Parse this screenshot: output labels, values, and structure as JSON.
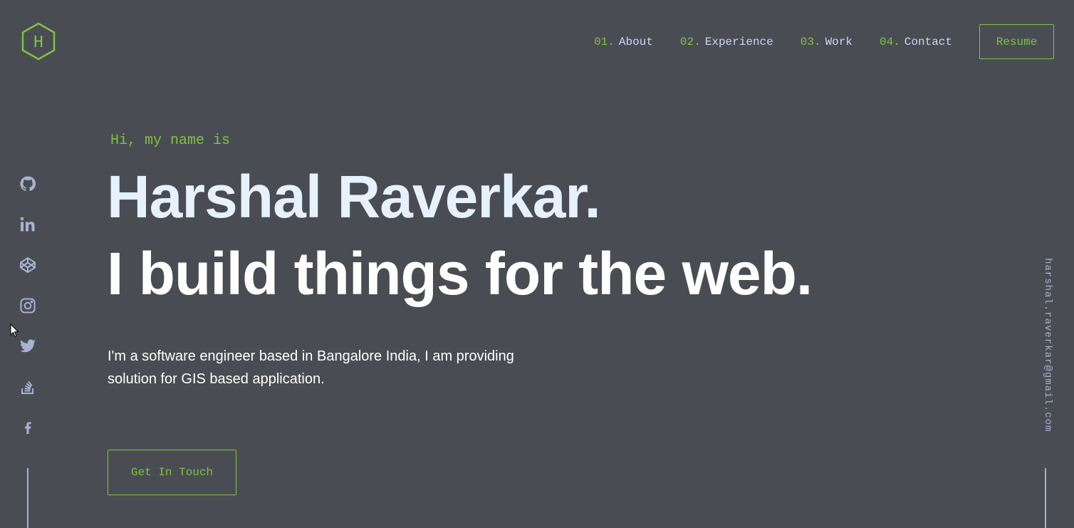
{
  "logo": {
    "letter": "H"
  },
  "nav": {
    "items": [
      {
        "num": "01.",
        "label": "About"
      },
      {
        "num": "02.",
        "label": "Experience"
      },
      {
        "num": "03.",
        "label": "Work"
      },
      {
        "num": "04.",
        "label": "Contact"
      }
    ],
    "resume_label": "Resume"
  },
  "hero": {
    "greeting": "Hi, my name is",
    "name": "Harshal Raverkar.",
    "tagline": "I build things for the web.",
    "description": "I'm a software engineer based in Bangalore India, I am providing solution for GIS based application.",
    "cta_label": "Get In Touch"
  },
  "social": {
    "icons": [
      "github-icon",
      "linkedin-icon",
      "codepen-icon",
      "instagram-icon",
      "twitter-icon",
      "stackoverflow-icon",
      "facebook-icon"
    ]
  },
  "email": "harshal.raverkar@gmail.com",
  "colors": {
    "background": "#4a4c53",
    "accent": "#7fc242",
    "heading": "#e6f1ff",
    "nav_text": "#ccd6f6",
    "muted": "#a8b2d1"
  }
}
